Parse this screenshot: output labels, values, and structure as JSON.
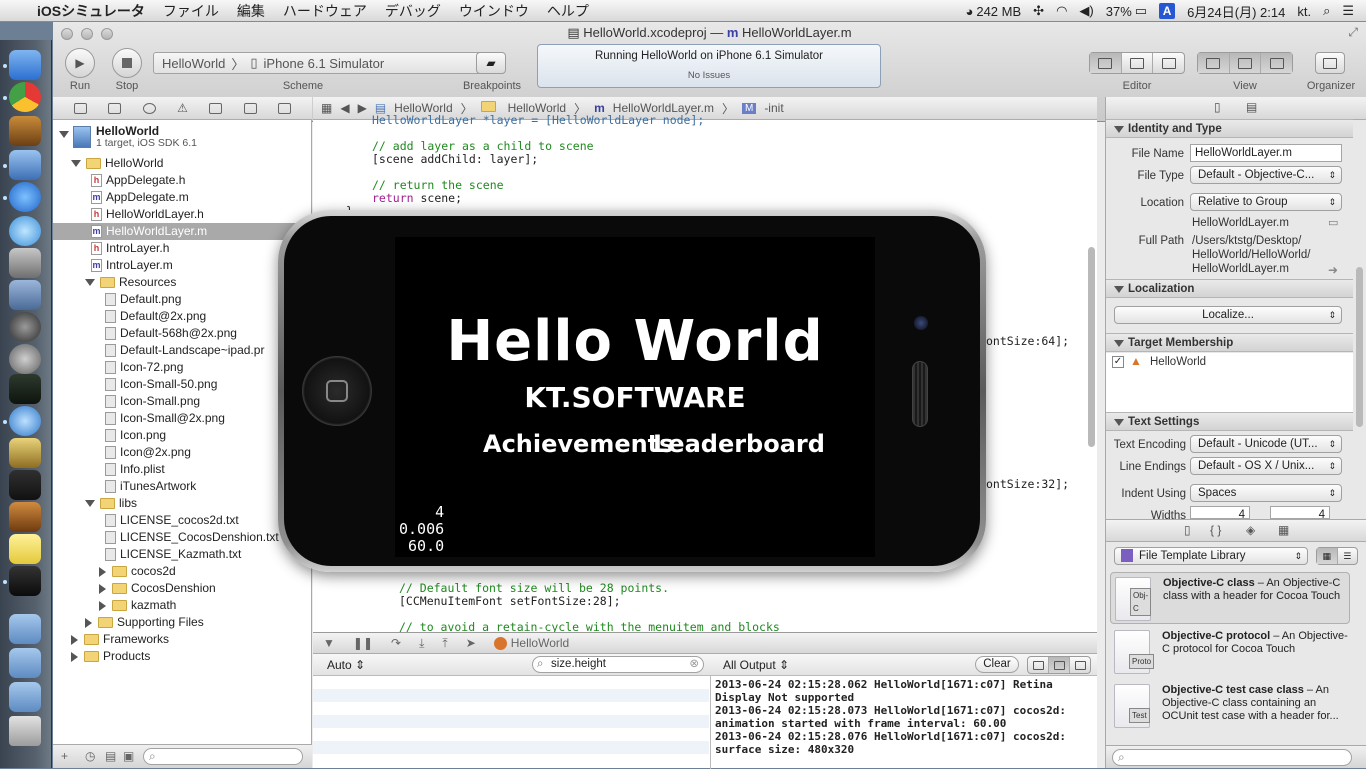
{
  "menubar": {
    "app": "iOSシミュレータ",
    "items": [
      "ファイル",
      "編集",
      "ハードウェア",
      "デバッグ",
      "ウインドウ",
      "ヘルプ"
    ],
    "status": {
      "memory": "242 MB",
      "battery": "37%",
      "ime": "A",
      "datetime": "6月24日(月) 2:14",
      "user": "kt."
    }
  },
  "window": {
    "title_project": "HelloWorld.xcodeproj",
    "title_sep": "—",
    "title_file": "HelloWorldLayer.m"
  },
  "toolbar": {
    "run_label": "Run",
    "stop_label": "Stop",
    "scheme_target": "HelloWorld",
    "scheme_sep": "〉",
    "scheme_device": "iPhone 6.1 Simulator",
    "scheme_label": "Scheme",
    "breakpoints_label": "Breakpoints",
    "activity_status": "Running HelloWorld on iPhone 6.1 Simulator",
    "activity_issues": "No Issues",
    "editor_label": "Editor",
    "view_label": "View",
    "organizer_label": "Organizer"
  },
  "navigator": {
    "project_name": "HelloWorld",
    "project_sub": "1 target, iOS SDK 6.1",
    "items": [
      {
        "label": "HelloWorld",
        "kind": "folder",
        "open": true
      },
      {
        "label": "AppDelegate.h",
        "kind": "h"
      },
      {
        "label": "AppDelegate.m",
        "kind": "m"
      },
      {
        "label": "HelloWorldLayer.h",
        "kind": "h"
      },
      {
        "label": "HelloWorldLayer.m",
        "kind": "m",
        "selected": true
      },
      {
        "label": "IntroLayer.h",
        "kind": "h"
      },
      {
        "label": "IntroLayer.m",
        "kind": "m"
      },
      {
        "label": "Resources",
        "kind": "folder",
        "open": true
      },
      {
        "label": "Default.png",
        "kind": "p"
      },
      {
        "label": "Default@2x.png",
        "kind": "p"
      },
      {
        "label": "Default-568h@2x.png",
        "kind": "p"
      },
      {
        "label": "Default-Landscape~ipad.pr",
        "kind": "p"
      },
      {
        "label": "Icon-72.png",
        "kind": "p"
      },
      {
        "label": "Icon-Small-50.png",
        "kind": "p"
      },
      {
        "label": "Icon-Small.png",
        "kind": "p"
      },
      {
        "label": "Icon-Small@2x.png",
        "kind": "p"
      },
      {
        "label": "Icon.png",
        "kind": "p"
      },
      {
        "label": "Icon@2x.png",
        "kind": "p"
      },
      {
        "label": "Info.plist",
        "kind": "p"
      },
      {
        "label": "iTunesArtwork",
        "kind": "p"
      },
      {
        "label": "libs",
        "kind": "folder",
        "open": true
      },
      {
        "label": "LICENSE_cocos2d.txt",
        "kind": "p"
      },
      {
        "label": "LICENSE_CocosDenshion.txt",
        "kind": "p"
      },
      {
        "label": "LICENSE_Kazmath.txt",
        "kind": "p"
      },
      {
        "label": "cocos2d",
        "kind": "folder",
        "open": false
      },
      {
        "label": "CocosDenshion",
        "kind": "folder",
        "open": false
      },
      {
        "label": "kazmath",
        "kind": "folder",
        "open": false
      },
      {
        "label": "Supporting Files",
        "kind": "folder",
        "open": false
      },
      {
        "label": "Frameworks",
        "kind": "folder",
        "open": false
      },
      {
        "label": "Products",
        "kind": "folder",
        "open": false
      }
    ]
  },
  "jumpbar": {
    "crumbs": [
      "HelloWorld",
      "HelloWorld",
      "HelloWorldLayer.m",
      "-init"
    ]
  },
  "code": {
    "line1_a": "HelloWorldLayer *layer = [HelloWorldLayer node];",
    "c1": "// add layer as a child to scene",
    "l2": "[scene addChild: layer];",
    "c2": "// return the scene",
    "kw_return": "return",
    "l3": " scene;",
    "brace": "}",
    "frag1": "ontSize:64];",
    "frag2": "ontSize:32];",
    "c3": "// Default font size will be 28 points.",
    "l4": "[CCMenuItemFont setFontSize:28];",
    "c4": "// to avoid a retain-cycle with the menuitem and blocks"
  },
  "debug": {
    "target": "HelloWorld",
    "auto_label": "Auto",
    "filter_value": "size.height",
    "output_label": "All Output",
    "clear_label": "Clear",
    "console": "2013-06-24 02:15:28.062 HelloWorld[1671:c07] Retina\nDisplay Not supported\n2013-06-24 02:15:28.073 HelloWorld[1671:c07] cocos2d:\nanimation started with frame interval: 60.00\n2013-06-24 02:15:28.076 HelloWorld[1671:c07] cocos2d:\nsurface size: 480x320"
  },
  "inspector": {
    "identity_header": "Identity and Type",
    "file_name_label": "File Name",
    "file_name": "HelloWorldLayer.m",
    "file_type_label": "File Type",
    "file_type": "Default - Objective-C...",
    "location_label": "Location",
    "location": "Relative to Group",
    "location_file": "HelloWorldLayer.m",
    "full_path_label": "Full Path",
    "full_path_1": "/Users/ktstg/Desktop/",
    "full_path_2": "HelloWorld/HelloWorld/",
    "full_path_3": "HelloWorldLayer.m",
    "localization_header": "Localization",
    "localize_button": "Localize...",
    "membership_header": "Target Membership",
    "membership_target": "HelloWorld",
    "text_settings_header": "Text Settings",
    "encoding_label": "Text Encoding",
    "encoding": "Default - Unicode (UT...",
    "line_endings_label": "Line Endings",
    "line_endings": "Default - OS X / Unix...",
    "indent_label": "Indent Using",
    "indent": "Spaces",
    "widths_label": "Widths",
    "width_tab": "4",
    "width_indent": "4",
    "library_select": "File Template Library",
    "library": [
      {
        "title": "Objective-C class",
        "desc": " – An Objective-C class with a header for Cocoa Touch",
        "badge": "Obj-C"
      },
      {
        "title": "Objective-C protocol",
        "desc": " – An Objective-C protocol for Cocoa Touch",
        "badge": "Proto"
      },
      {
        "title": "Objective-C test case class",
        "desc": " – An Objective-C class containing an OCUnit test case with a header for...",
        "badge": "Test"
      }
    ]
  },
  "simulator": {
    "game_title": "Hello World",
    "game_subtitle": "KT.SOFTWARE",
    "menu_achievements": "Achievements",
    "menu_leaderboard": "Leaderboard",
    "stats": "    4\n0.006\n60.0"
  }
}
